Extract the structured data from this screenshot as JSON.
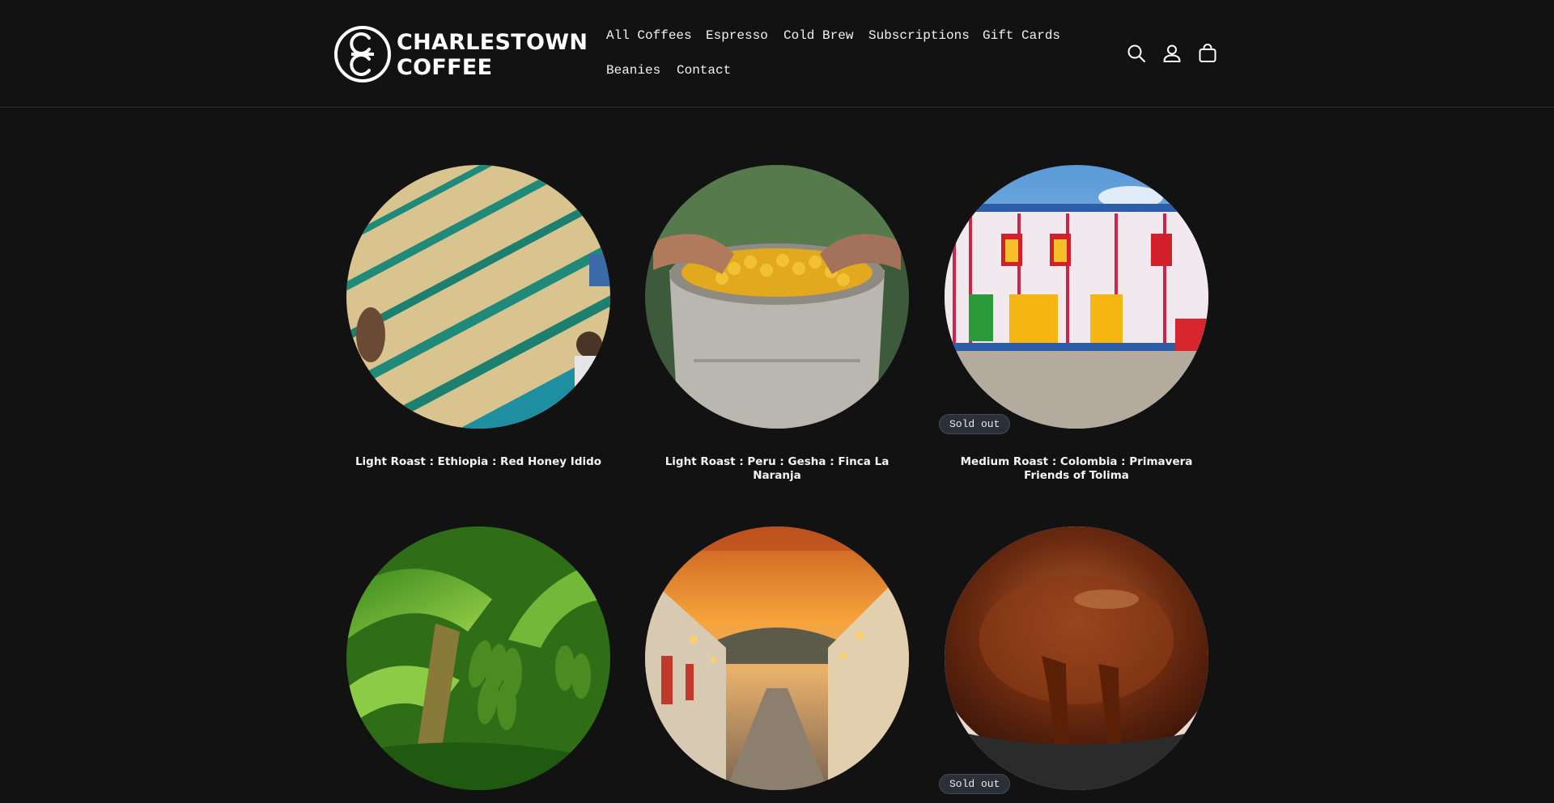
{
  "brand": {
    "line1": "CHARLESTOWN",
    "line2": "COFFEE",
    "monogram": "CC"
  },
  "nav": {
    "items": [
      {
        "label": "All Coffees",
        "name": "nav-all-coffees"
      },
      {
        "label": "Espresso",
        "name": "nav-espresso"
      },
      {
        "label": "Cold Brew",
        "name": "nav-cold-brew"
      },
      {
        "label": "Subscriptions",
        "name": "nav-subscriptions"
      },
      {
        "label": "Gift Cards",
        "name": "nav-gift-cards"
      },
      {
        "label": "Beanies",
        "name": "nav-beanies"
      },
      {
        "label": "Contact",
        "name": "nav-contact"
      }
    ]
  },
  "header_icons": [
    "search-icon",
    "account-icon",
    "cart-icon"
  ],
  "products": [
    {
      "title": "Light Roast : Ethiopia : Red Honey Idido",
      "image": "drying-beds-photo",
      "badge": ""
    },
    {
      "title": "Light Roast : Peru : Gesha : Finca La Naranja",
      "image": "coffee-cherries-bucket-photo",
      "badge": ""
    },
    {
      "title": "Medium Roast : Colombia : Primavera Friends of Tolima",
      "image": "colorful-colonial-building-photo",
      "badge": "Sold out"
    },
    {
      "title": "",
      "image": "banana-plant-photo",
      "badge": ""
    },
    {
      "title": "",
      "image": "sunset-town-street-photo",
      "badge": ""
    },
    {
      "title": "",
      "image": "chocolate-pour-photo",
      "badge": "Sold out"
    }
  ],
  "colors": {
    "background": "#121212",
    "text": "#ffffff",
    "badge_bg": "#2a2f38"
  }
}
